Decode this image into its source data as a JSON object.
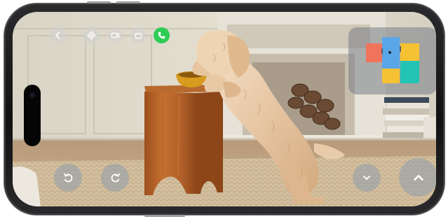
{
  "device": {
    "type": "phone-landscape"
  },
  "camera_view": {
    "scene": "live-camera-feed"
  },
  "top_controls": [
    {
      "name": "back-button",
      "icon": "chevron-left-icon"
    },
    {
      "name": "settings-button",
      "icon": "gear-icon"
    },
    {
      "name": "video-record-button",
      "icon": "video-camera-icon"
    },
    {
      "name": "treat-button",
      "icon": "bowl-icon"
    },
    {
      "name": "call-button",
      "icon": "phone-icon",
      "color": "#2dcc55"
    }
  ],
  "bottom_controls": {
    "rotate_left": {
      "icon": "rotate-left-icon"
    },
    "rotate_right": {
      "icon": "rotate-right-icon"
    },
    "move_down": {
      "icon": "chevron-down-icon"
    },
    "move_up": {
      "icon": "chevron-up-icon"
    }
  },
  "minimap": {
    "rooms": [
      {
        "name": "room-orange",
        "color": "#f0735c"
      },
      {
        "name": "room-blue",
        "color": "#5aa6e8"
      },
      {
        "name": "room-yellow-top",
        "color": "#f5c233"
      },
      {
        "name": "room-yellow-bottom",
        "color": "#f5c233"
      },
      {
        "name": "room-teal",
        "color": "#23c3b5"
      }
    ],
    "current_location_marker": true
  }
}
